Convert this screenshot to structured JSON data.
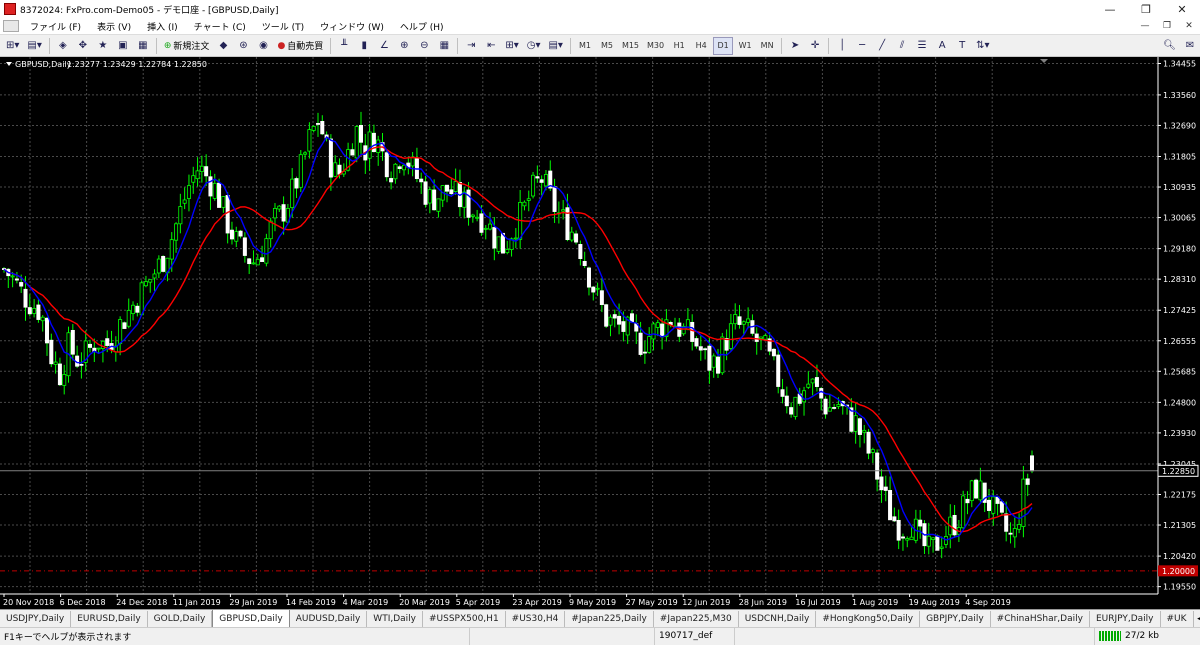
{
  "window": {
    "title": "8372024: FxPro.com-Demo05 - デモ口座 - [GBPUSD,Daily]"
  },
  "menu": [
    "ファイル (F)",
    "表示 (V)",
    "挿入 (I)",
    "チャート (C)",
    "ツール (T)",
    "ウィンドウ (W)",
    "ヘルプ (H)"
  ],
  "toolbar": {
    "new_order": "新規注文",
    "autotrade": "自動売買",
    "timeframes": [
      "M1",
      "M5",
      "M15",
      "M30",
      "H1",
      "H4",
      "D1",
      "W1",
      "MN"
    ],
    "active_timeframe": "D1"
  },
  "chart_data": {
    "type": "candlestick",
    "symbol_label": "GBPUSD,Daily",
    "ohlc_header": "1.23277 1.23429 1.22784 1.22850",
    "current_price": "1.22850",
    "red_line_price": "1.20000",
    "y_ticks": [
      "1.34455",
      "1.33560",
      "1.32690",
      "1.31805",
      "1.30935",
      "1.30065",
      "1.29180",
      "1.28310",
      "1.27425",
      "1.26555",
      "1.25685",
      "1.24800",
      "1.23930",
      "1.23045",
      "1.22175",
      "1.21305",
      "1.20420",
      "1.19550"
    ],
    "x_ticks": [
      "20 Nov 2018",
      "6 Dec 2018",
      "24 Dec 2018",
      "11 Jan 2019",
      "29 Jan 2019",
      "14 Feb 2019",
      "4 Mar 2019",
      "20 Mar 2019",
      "5 Apr 2019",
      "23 Apr 2019",
      "9 May 2019",
      "27 May 2019",
      "12 Jun 2019",
      "28 Jun 2019",
      "16 Jul 2019",
      "1 Aug 2019",
      "19 Aug 2019",
      "4 Sep 2019"
    ],
    "ylim": [
      1.1934,
      1.3464
    ],
    "grid": true,
    "series": [
      {
        "name": "GBPUSD Daily close",
        "color": "#00ff00"
      },
      {
        "name": "MA fast",
        "color": "#0000ff"
      },
      {
        "name": "MA slow",
        "color": "#ff0000"
      }
    ],
    "close_path": [
      1.286,
      1.283,
      1.279,
      1.276,
      1.274,
      1.262,
      1.256,
      1.264,
      1.26,
      1.262,
      1.266,
      1.264,
      1.268,
      1.272,
      1.276,
      1.28,
      1.284,
      1.288,
      1.294,
      1.302,
      1.31,
      1.315,
      1.312,
      1.308,
      1.3,
      1.294,
      1.29,
      1.288,
      1.292,
      1.299,
      1.302,
      1.307,
      1.314,
      1.323,
      1.329,
      1.318,
      1.312,
      1.318,
      1.326,
      1.32,
      1.324,
      1.318,
      1.314,
      1.32,
      1.315,
      1.31,
      1.306,
      1.307,
      1.309,
      1.306,
      1.304,
      1.302,
      1.3,
      1.295,
      1.292,
      1.298,
      1.302,
      1.308,
      1.312,
      1.306,
      1.301,
      1.298,
      1.294,
      1.286,
      1.278,
      1.272,
      1.27,
      1.269,
      1.266,
      1.265,
      1.268,
      1.27,
      1.272,
      1.269,
      1.267,
      1.264,
      1.259,
      1.26,
      1.266,
      1.27,
      1.269,
      1.266,
      1.264,
      1.258,
      1.252,
      1.247,
      1.25,
      1.254,
      1.25,
      1.246,
      1.248,
      1.244,
      1.242,
      1.236,
      1.23,
      1.221,
      1.215,
      1.212,
      1.214,
      1.208,
      1.205,
      1.209,
      1.212,
      1.215,
      1.22,
      1.224,
      1.221,
      1.216,
      1.212,
      1.208,
      1.222,
      1.2285
    ]
  },
  "tabs": [
    "USDJPY,Daily",
    "EURUSD,Daily",
    "GOLD,Daily",
    "GBPUSD,Daily",
    "AUDUSD,Daily",
    "WTI,Daily",
    "#USSPX500,H1",
    "#US30,H4",
    "#Japan225,Daily",
    "#Japan225,M30",
    "USDCNH,Daily",
    "#HongKong50,Daily",
    "GBPJPY,Daily",
    "#ChinaHShar,Daily",
    "EURJPY,Daily",
    "#UK"
  ],
  "active_tab": "GBPUSD,Daily",
  "status": {
    "help": "F1キーでヘルプが表示されます",
    "profile": "190717_def",
    "connection": "27/2 kb"
  }
}
